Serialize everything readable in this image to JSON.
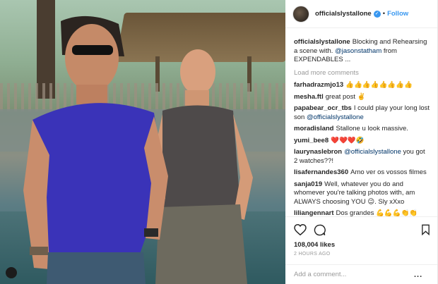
{
  "header": {
    "username": "officialslystallone",
    "follow_label": "Follow",
    "separator": "•"
  },
  "caption": {
    "user": "officialslystallone",
    "text_before": "Blocking and Rehearsing a scene with. ",
    "mention": "@jasonstatham",
    "text_after": " from EXPENDABLES ..."
  },
  "load_more_label": "Load more comments",
  "comments": [
    {
      "user": "farhadrazmjo13",
      "text": "👍👍👍👍👍👍👍👍"
    },
    {
      "user": "mesha.ftl",
      "text": "great post ✌️"
    },
    {
      "user": "papabear_ocr_tbs",
      "text": "I could play your long lost son ",
      "mention": "@officialslystallone"
    },
    {
      "user": "moradisland",
      "text": "Stallone u look massive."
    },
    {
      "user": "yumi_bee8",
      "text": "❤️❤️❤️🤣"
    },
    {
      "user": "laurynaslebron",
      "text": "",
      "mention": "@officialslystallone",
      "text_after": " you got 2 watches??!"
    },
    {
      "user": "lisafernandes360",
      "text": "Amo ver os vossos filmes"
    },
    {
      "user": "sanja019",
      "text": "Well, whatever you do and whomever you're talking photos with, am ALWAYS choosing YOU 😉. Sly xXxo"
    },
    {
      "user": "liliangennart",
      "text": "Dos grandes 💪💪💪👏👏"
    }
  ],
  "likes": "108,004 likes",
  "time_ago": "2 HOURS AGO",
  "add_comment": {
    "placeholder": "Add a comment...",
    "more": "..."
  },
  "icons": {
    "like": "heart-icon",
    "comment": "comment-icon",
    "save": "bookmark-icon",
    "verified": "verified-icon"
  },
  "colors": {
    "accent": "#3897f0",
    "mention": "#003569",
    "muted": "#999999"
  }
}
